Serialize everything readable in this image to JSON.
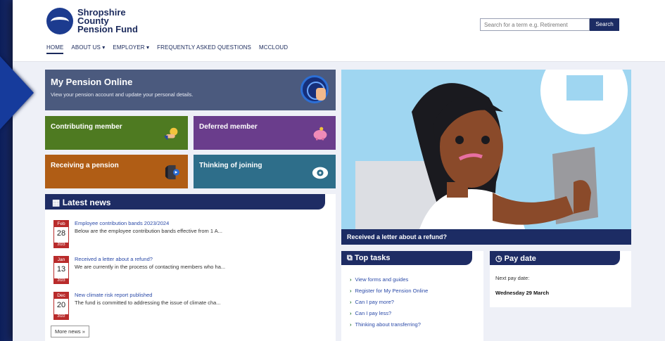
{
  "brand": {
    "line1": "Shropshire",
    "line2": "County",
    "line3": "Pension Fund"
  },
  "nav": {
    "items": [
      {
        "label": "HOME"
      },
      {
        "label": "ABOUT US ▾"
      },
      {
        "label": "EMPLOYER ▾"
      },
      {
        "label": "FREQUENTLY ASKED QUESTIONS"
      },
      {
        "label": "MCCLOUD"
      }
    ]
  },
  "search": {
    "placeholder": "Search for a term e.g. Retirement",
    "button": "Search"
  },
  "tiles": {
    "mpo": {
      "title": "My Pension Online",
      "desc": "View your pension account and update your personal details."
    },
    "contrib": {
      "label": "Contributing member"
    },
    "deferred": {
      "label": "Deferred member"
    },
    "receiving": {
      "label": "Receiving a pension"
    },
    "thinking": {
      "label": "Thinking of joining"
    }
  },
  "news": {
    "heading": "Latest news",
    "items": [
      {
        "month": "Feb",
        "day": "28",
        "year": "2023",
        "title": "Employee contribution bands 2023/2024",
        "desc": "Below are the employee contribution bands effective from 1 A..."
      },
      {
        "month": "Jan",
        "day": "13",
        "year": "2023",
        "title": "Received a letter about a refund?",
        "desc": "We are currently in the process of contacting members who ha..."
      },
      {
        "month": "Dec",
        "day": "20",
        "year": "2022",
        "title": "New climate risk report published",
        "desc": "The fund is committed to addressing the issue of climate cha..."
      }
    ],
    "more": "More news »"
  },
  "hero": {
    "caption": "Received a letter about a refund?"
  },
  "tasks": {
    "heading": "Top tasks",
    "items": [
      {
        "label": "View forms and guides"
      },
      {
        "label": "Register for My Pension Online"
      },
      {
        "label": "Can I pay more?"
      },
      {
        "label": "Can I pay less?"
      },
      {
        "label": "Thinking about transferring?"
      }
    ]
  },
  "pay": {
    "heading": "Pay date",
    "label": "Next pay date:",
    "value": "Wednesday 29 March"
  },
  "colors": {
    "navy": "#1e2c64",
    "mpo": "#4b5a7e",
    "contrib": "#4e7a21",
    "deferred": "#6a3d8c",
    "receiving": "#b05d15",
    "thinking": "#2e6e8a",
    "hero_bg": "#9fd6f1",
    "badge_red": "#b92b2b"
  }
}
